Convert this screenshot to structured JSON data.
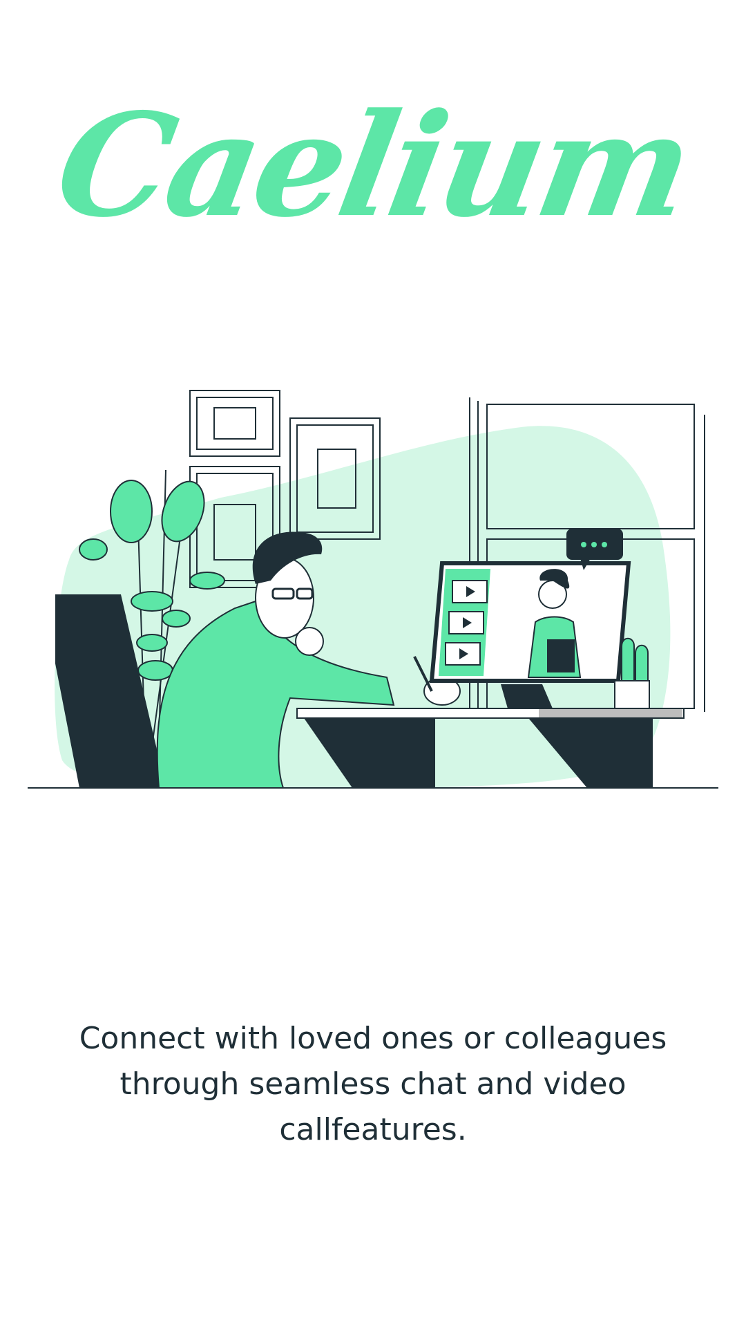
{
  "app": {
    "logo_text": "Caelium",
    "brand_color": "#5de6a7",
    "text_color": "#1f2f37"
  },
  "onboarding": {
    "illustration_icon": "video-call-illustration",
    "tagline": "Connect with loved ones or colleagues through seamless chat and video callfeatures."
  }
}
